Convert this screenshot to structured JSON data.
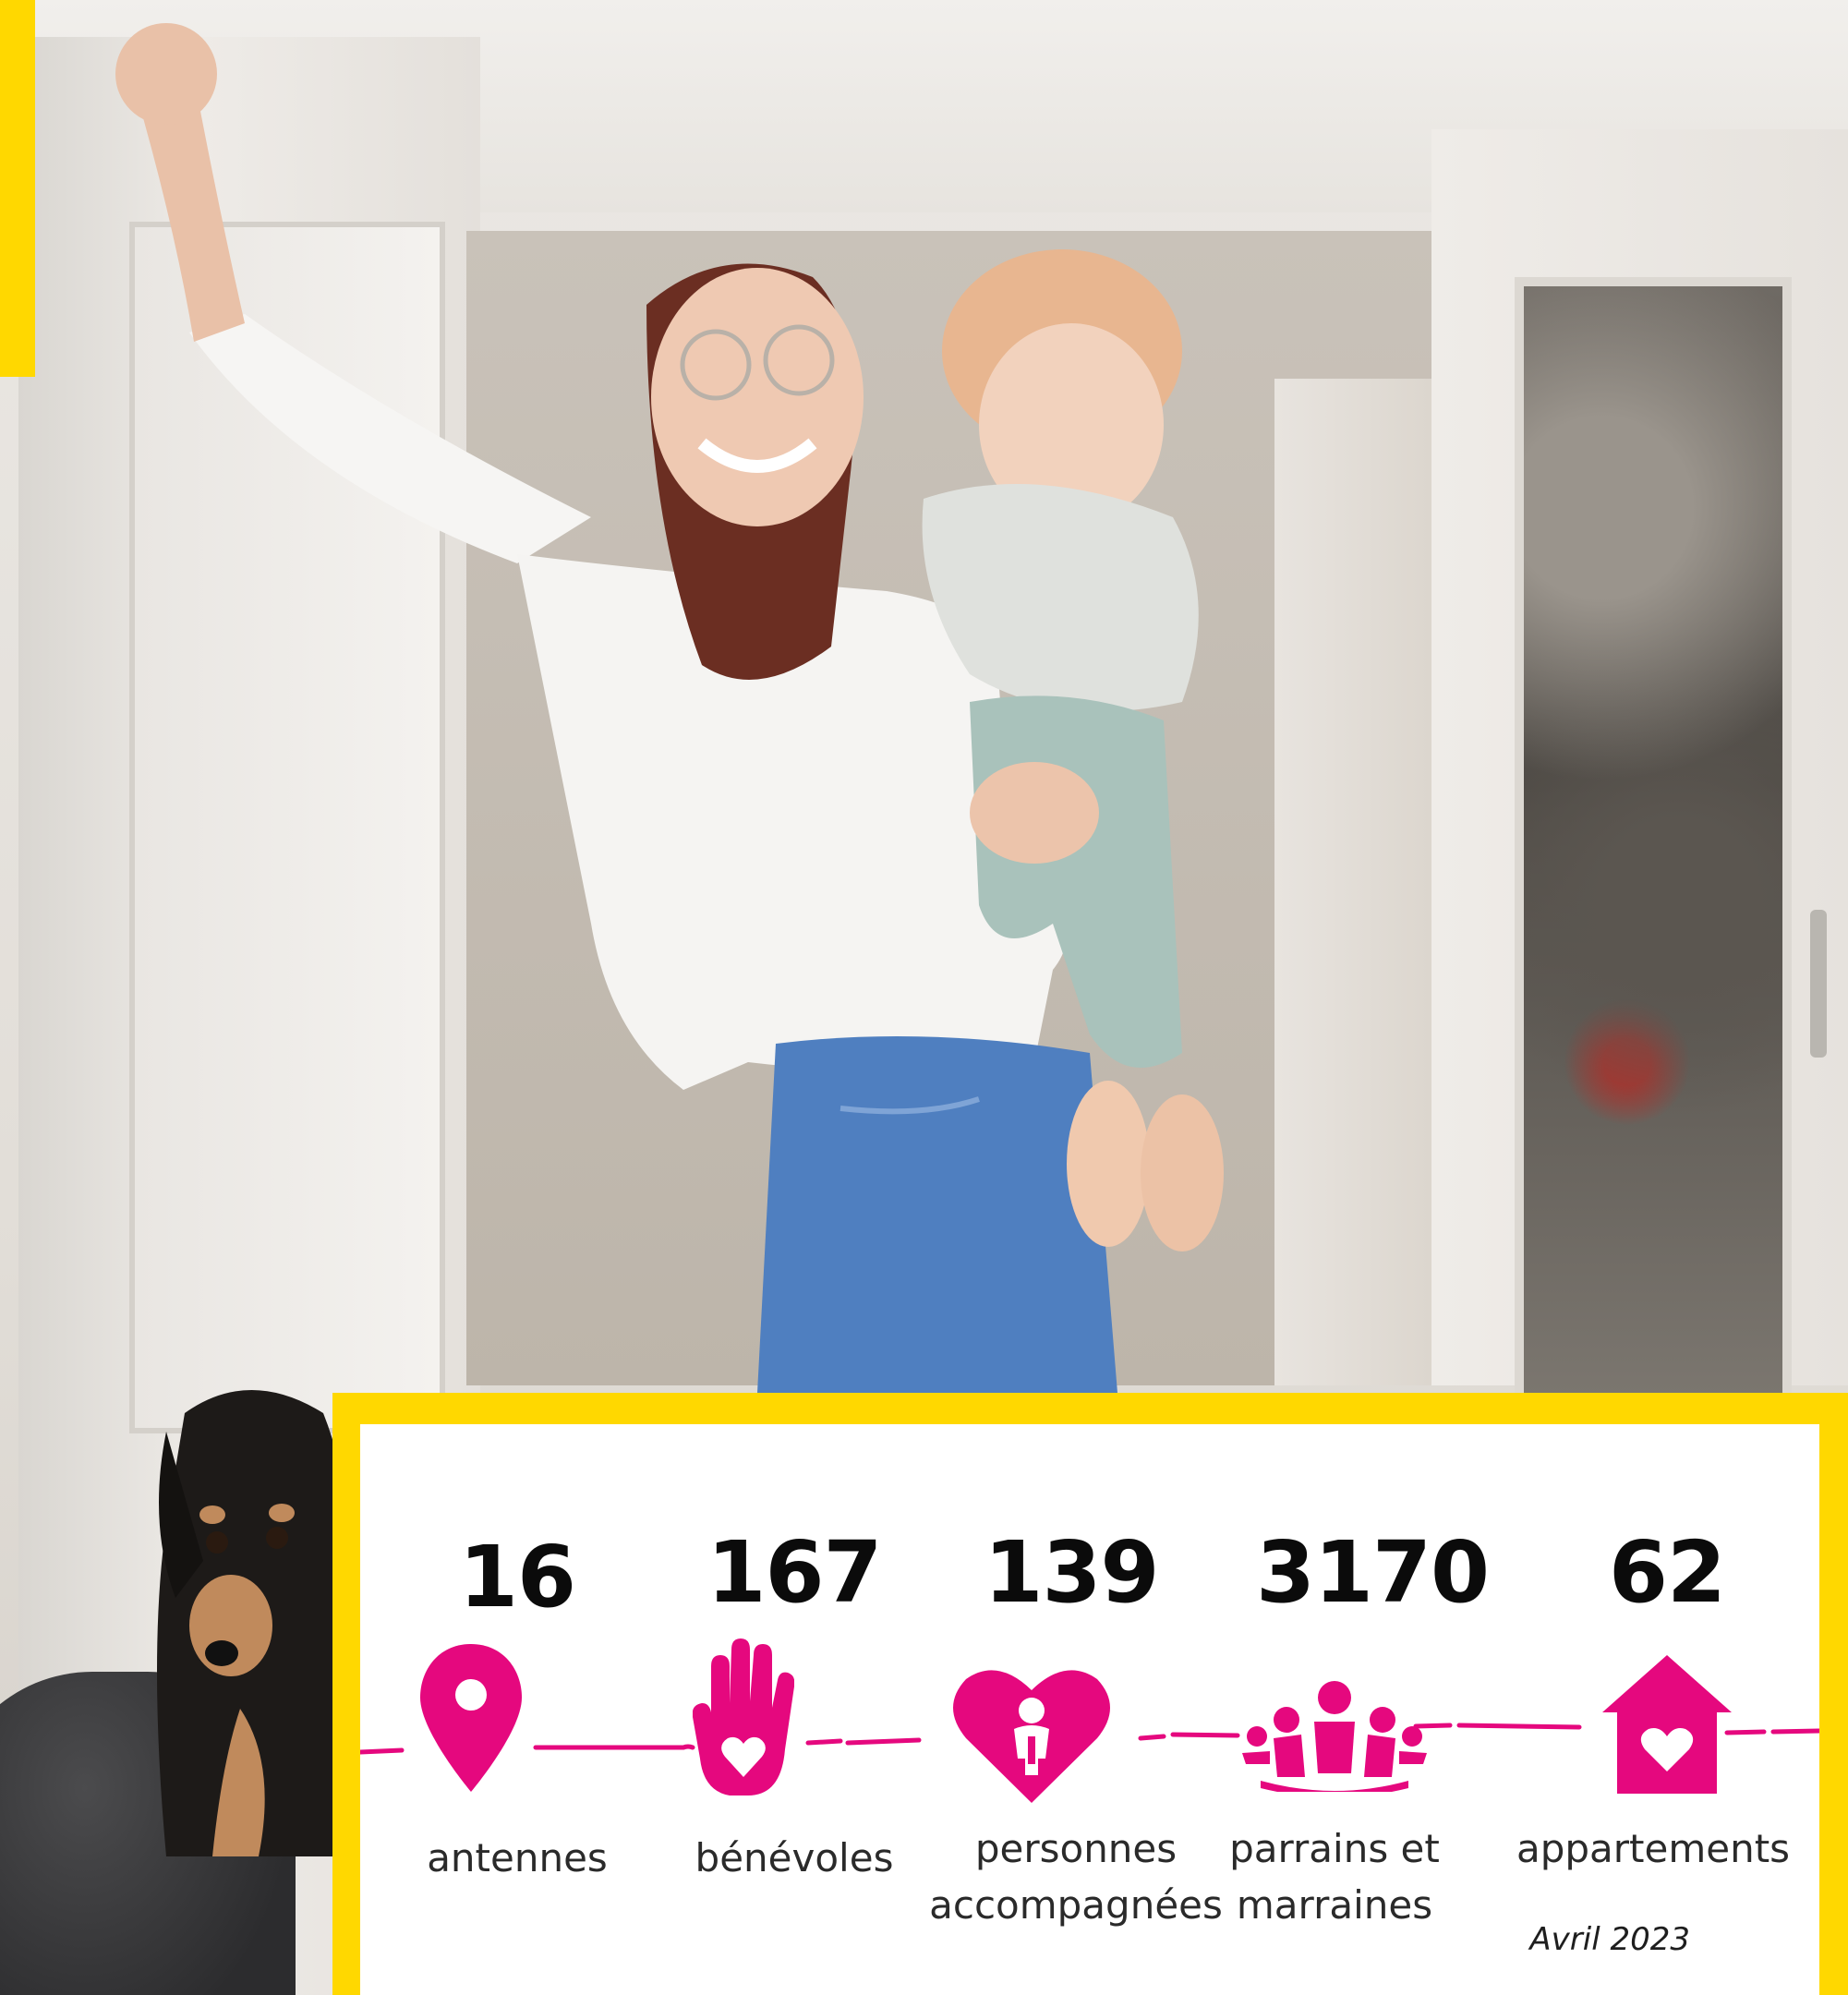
{
  "accent_colors": {
    "yellow": "#ffd800",
    "pink": "#e5087e"
  },
  "stats": [
    {
      "value": "16",
      "label": "antennes",
      "icon": "map-pin-icon"
    },
    {
      "value": "167",
      "label": "bénévoles",
      "icon": "hand-heart-icon"
    },
    {
      "value": "139",
      "label": "personnes accompagnées",
      "icon": "heart-person-icon"
    },
    {
      "value": "3170",
      "label": "parrains et marraines",
      "icon": "group-people-icon"
    },
    {
      "value": "62",
      "label": "appartements",
      "icon": "house-heart-icon"
    }
  ],
  "date_stamp": "Avril 2023"
}
